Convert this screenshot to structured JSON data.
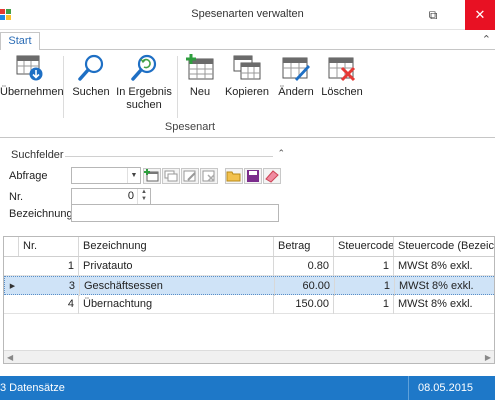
{
  "window": {
    "title": "Spesenarten verwalten",
    "restore_glyph": "⧉",
    "close_glyph": "✕"
  },
  "ribbon": {
    "tab_start": "Start",
    "collapse_glyph": "⌃",
    "buttons": [
      {
        "label": "Übernehmen",
        "icon": "table-download-icon"
      },
      {
        "label": "Suchen",
        "icon": "magnifier-icon"
      },
      {
        "label": "In Ergebnis\nsuchen",
        "icon": "magnifier-refresh-icon"
      },
      {
        "label": "Neu",
        "icon": "table-add-icon"
      },
      {
        "label": "Kopieren",
        "icon": "table-copy-icon"
      },
      {
        "label": "Ändern",
        "icon": "table-edit-icon"
      },
      {
        "label": "Löschen",
        "icon": "table-delete-icon"
      }
    ],
    "group_label": "Spesenart"
  },
  "search": {
    "title": "Suchfelder",
    "collapse_glyph": "⌃",
    "abfrage_label": "Abfrage",
    "abfrage_value": "",
    "nr_label": "Nr.",
    "nr_value": "0",
    "bezeichnung_label": "Bezeichnung",
    "bezeichnung_value": ""
  },
  "grid": {
    "columns": [
      "Nr.",
      "Bezeichnung",
      "Betrag",
      "Steuercode",
      "Steuercode (Bezeichnung)"
    ],
    "rows": [
      {
        "nr": "1",
        "bezeichnung": "Privatauto",
        "betrag": "0.80",
        "steuercode": "1",
        "steuercode_bez": "MWSt 8% exkl.",
        "selected": false
      },
      {
        "nr": "3",
        "bezeichnung": "Geschäftsessen",
        "betrag": "60.00",
        "steuercode": "1",
        "steuercode_bez": "MWSt 8% exkl.",
        "selected": true
      },
      {
        "nr": "4",
        "bezeichnung": "Übernachtung",
        "betrag": "150.00",
        "steuercode": "1",
        "steuercode_bez": "MWSt 8% exkl.",
        "selected": false
      }
    ],
    "row_indicator_glyph": "▶"
  },
  "status": {
    "count": "3 Datensätze",
    "date": "08.05.2015"
  },
  "colors": {
    "accent": "#1e78c8",
    "close": "#e81123",
    "selection": "#cfe3f7"
  }
}
